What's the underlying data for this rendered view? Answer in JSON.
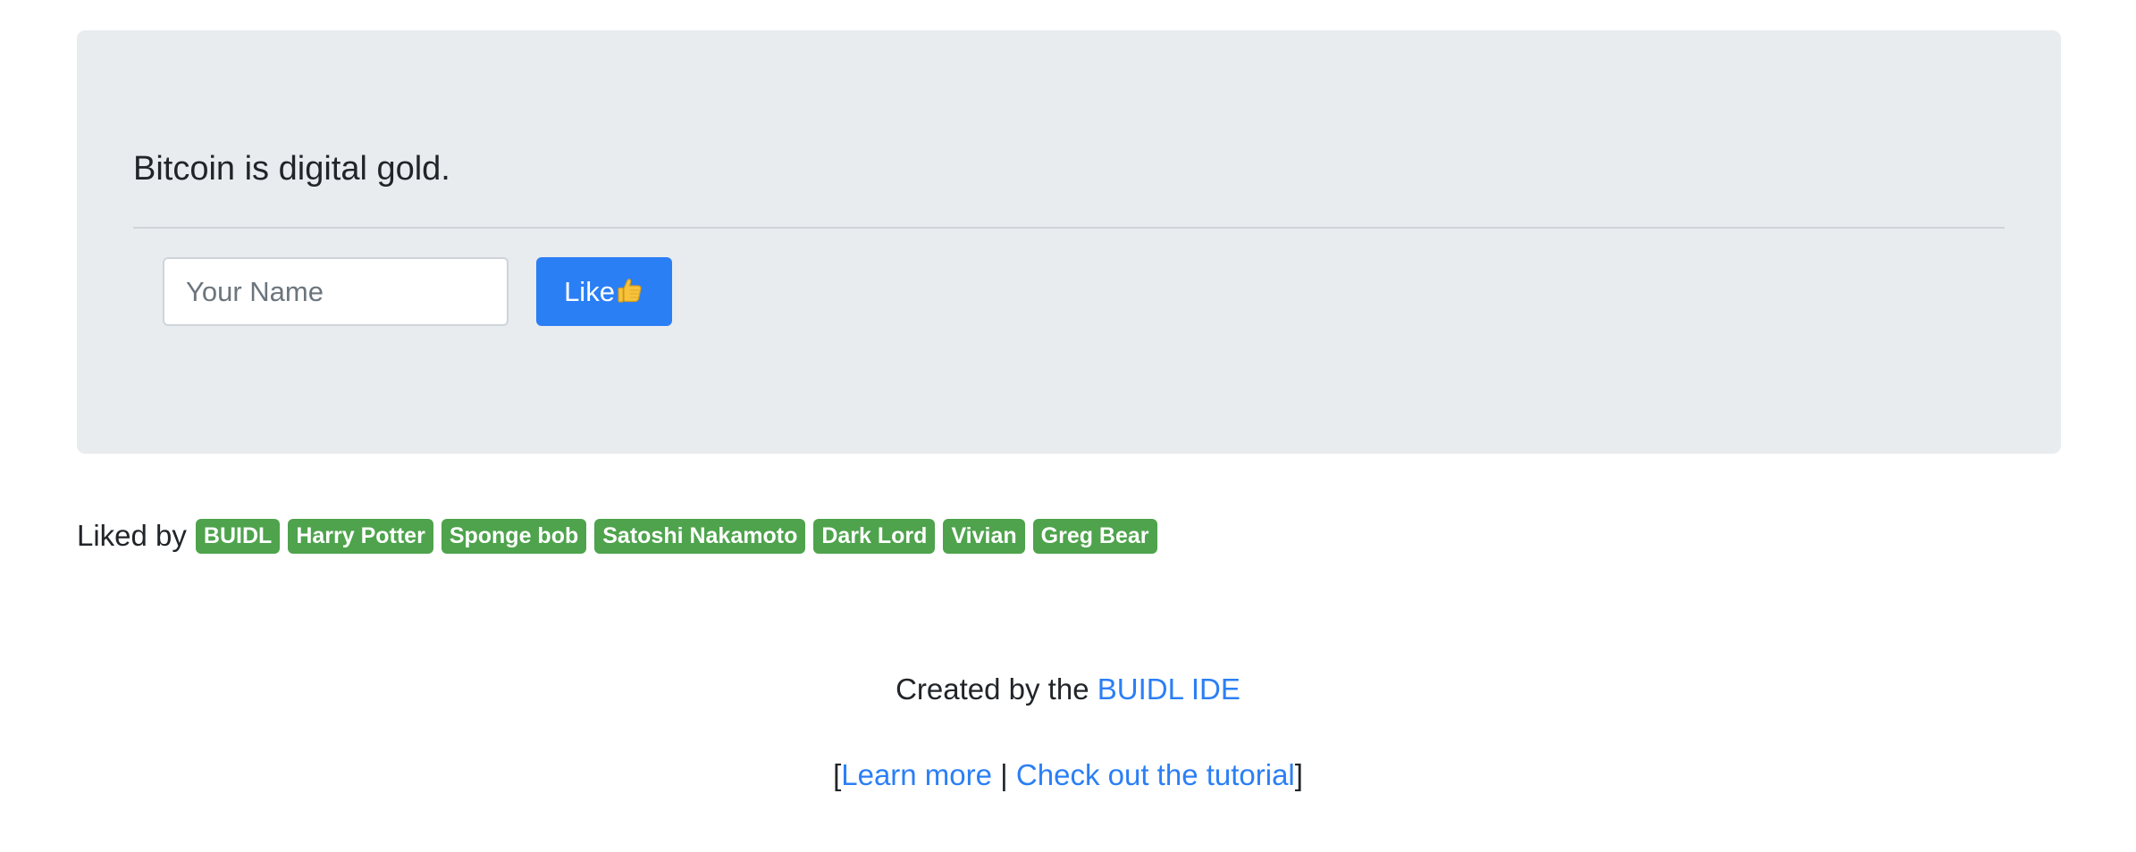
{
  "jumbotron": {
    "quote": "Bitcoin is digital gold.",
    "name_input": {
      "placeholder": "Your Name",
      "value": ""
    },
    "like_button": {
      "label": "Like",
      "icon": "thumbs-up-icon"
    }
  },
  "likes": {
    "label": "Liked by",
    "names": [
      "BUIDL",
      "Harry Potter",
      "Sponge bob",
      "Satoshi Nakamoto",
      "Dark Lord",
      "Vivian",
      "Greg Bear"
    ]
  },
  "footer": {
    "credit_prefix": "Created by the ",
    "credit_link": "BUIDL IDE",
    "bracket_open": "[",
    "learn_more": "Learn more",
    "separator": " | ",
    "tutorial": "Check out the tutorial",
    "bracket_close": "]"
  },
  "colors": {
    "jumbotron_bg": "#e9ecef",
    "primary": "#2b7ff5",
    "badge_success": "#4ea34c",
    "text": "#212529"
  }
}
